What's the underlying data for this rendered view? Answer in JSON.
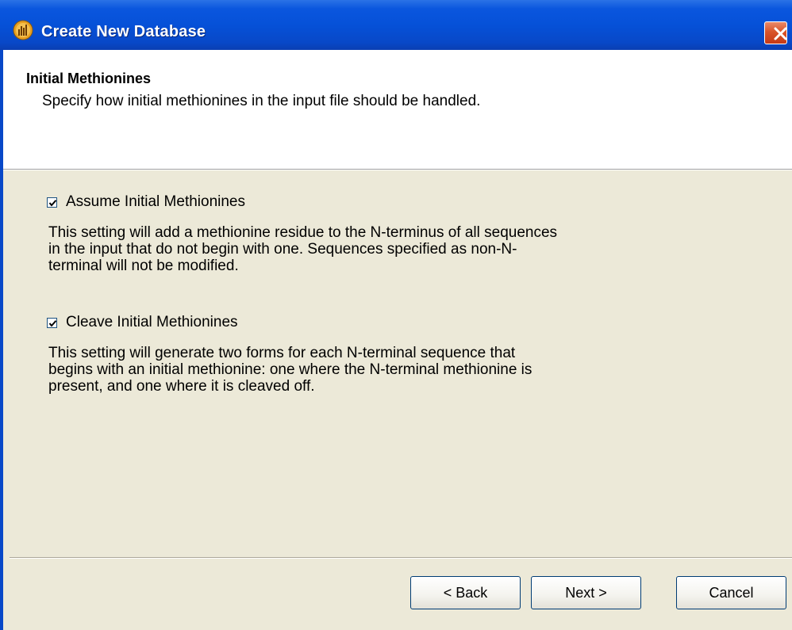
{
  "window": {
    "title": "Create New Database",
    "app_icon": "app-chart-icon",
    "close_icon": "close-icon",
    "close_color": "#d9542a",
    "titlebar_color": "#0651d8"
  },
  "header": {
    "title": "Initial Methionines",
    "subtitle": "Specify how initial methionines in the input file should be handled."
  },
  "options": [
    {
      "label": "Assume Initial Methionines",
      "checked": true,
      "description_lines": [
        "This setting will add a methionine residue to the N-terminus of all sequences",
        "in the input that do not begin with one.  Sequences specified as non-N-",
        "terminal will not be modified."
      ]
    },
    {
      "label": "Cleave Initial Methionines",
      "checked": true,
      "description_lines": [
        "This setting will generate two forms for each N-terminal sequence that",
        "begins with an initial methionine: one where the N-terminal methionine is",
        "present, and one where it is cleaved off."
      ]
    }
  ],
  "buttons": {
    "back": "< Back",
    "next": "Next >",
    "cancel": "Cancel"
  }
}
